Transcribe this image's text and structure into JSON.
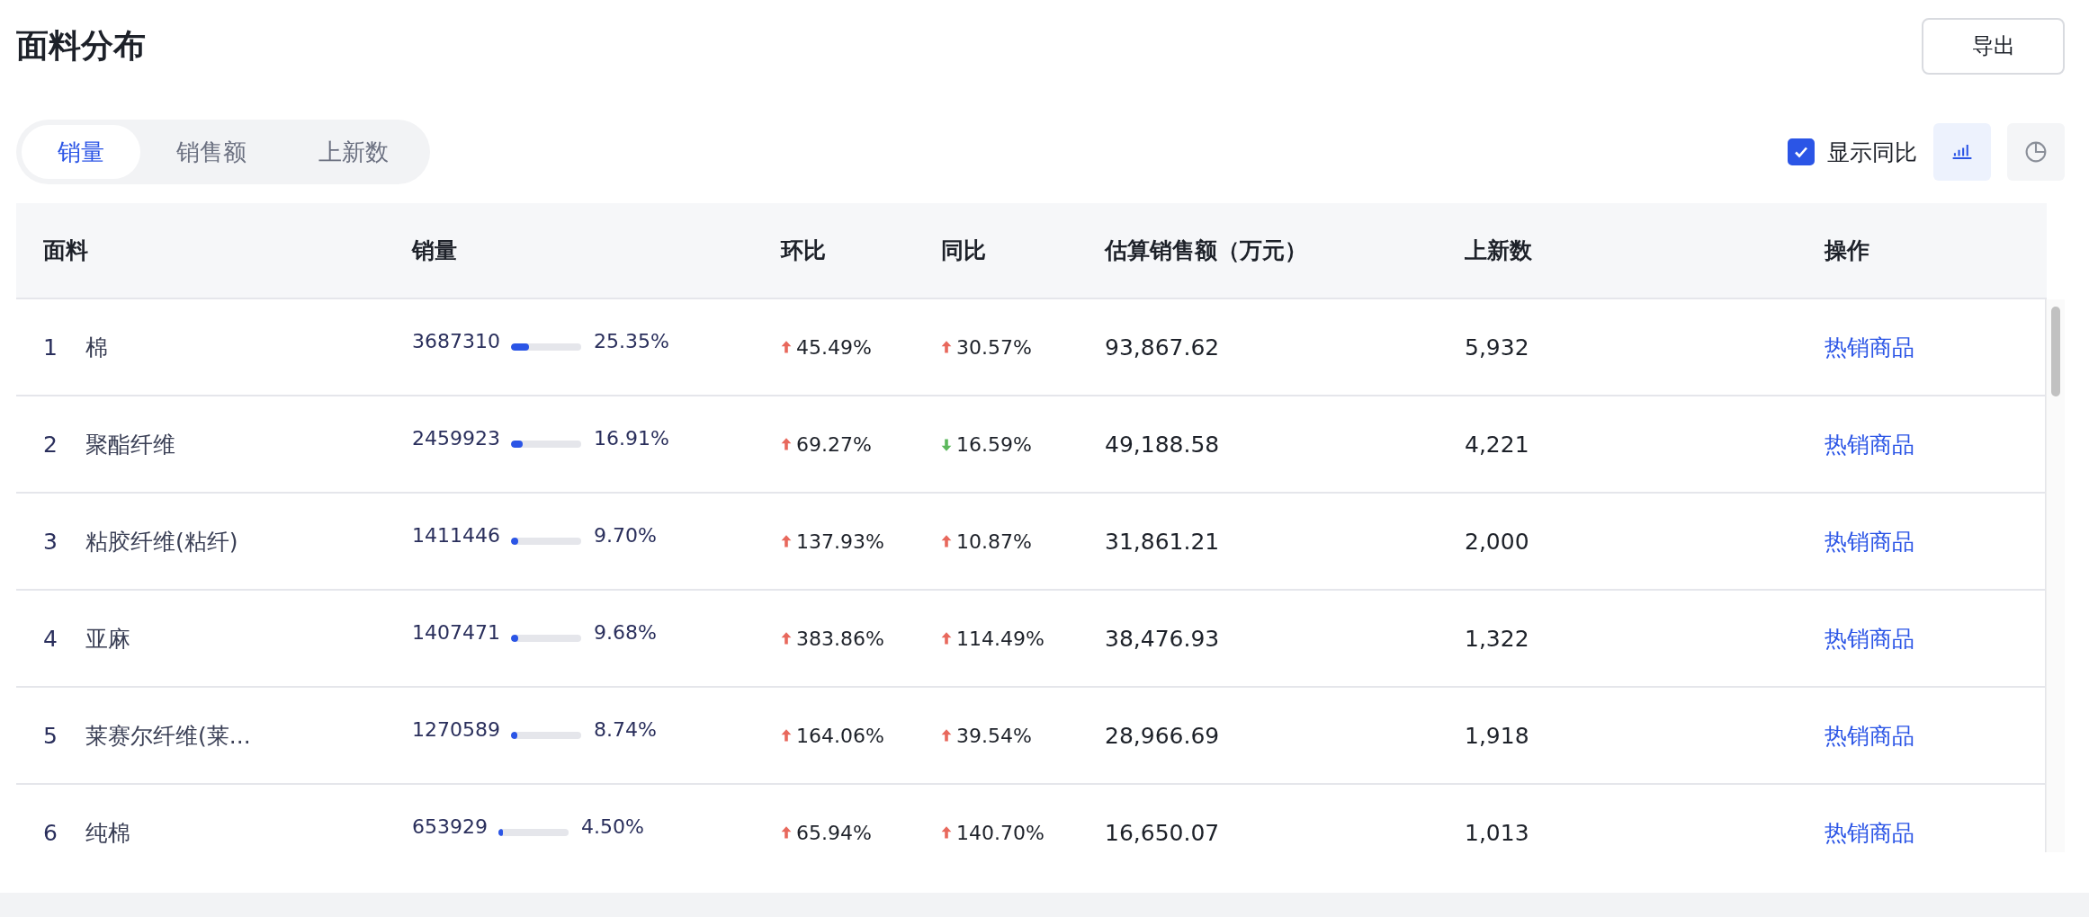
{
  "title": "面料分布",
  "export_button": "导出",
  "tabs": [
    {
      "label": "销量",
      "selected": true
    },
    {
      "label": "销售额",
      "selected": false
    },
    {
      "label": "上新数",
      "selected": false
    }
  ],
  "show_yoy": {
    "label": "显示同比",
    "checked": true
  },
  "view_toggle": [
    {
      "kind": "bar",
      "selected": true
    },
    {
      "kind": "pie",
      "selected": false
    }
  ],
  "table": {
    "columns": [
      "面料",
      "销量",
      "环比",
      "同比",
      "估算销售额（万元）",
      "上新数",
      "操作"
    ],
    "rows": [
      {
        "rank": "1",
        "name": "棉",
        "sales": "3687310",
        "level": 0.2535,
        "share": "25.35%",
        "mom": {
          "kind": "up",
          "value": "45.49%"
        },
        "yoy": {
          "kind": "up",
          "value": "30.57%"
        },
        "revenue": "93,867.62",
        "new": "5,932",
        "action": "热销商品"
      },
      {
        "rank": "2",
        "name": "聚酯纤维",
        "sales": "2459923",
        "level": 0.1691,
        "share": "16.91%",
        "mom": {
          "kind": "up",
          "value": "69.27%"
        },
        "yoy": {
          "kind": "down",
          "value": "16.59%"
        },
        "revenue": "49,188.58",
        "new": "4,221",
        "action": "热销商品"
      },
      {
        "rank": "3",
        "name": "粘胶纤维(粘纤)",
        "sales": "1411446",
        "level": 0.097,
        "share": "9.70%",
        "mom": {
          "kind": "up",
          "value": "137.93%"
        },
        "yoy": {
          "kind": "up",
          "value": "10.87%"
        },
        "revenue": "31,861.21",
        "new": "2,000",
        "action": "热销商品"
      },
      {
        "rank": "4",
        "name": "亚麻",
        "sales": "1407471",
        "level": 0.0968,
        "share": "9.68%",
        "mom": {
          "kind": "up",
          "value": "383.86%"
        },
        "yoy": {
          "kind": "up",
          "value": "114.49%"
        },
        "revenue": "38,476.93",
        "new": "1,322",
        "action": "热销商品"
      },
      {
        "rank": "5",
        "name": "莱赛尔纤维(莱...",
        "sales": "1270589",
        "level": 0.0874,
        "share": "8.74%",
        "mom": {
          "kind": "up",
          "value": "164.06%"
        },
        "yoy": {
          "kind": "up",
          "value": "39.54%"
        },
        "revenue": "28,966.69",
        "new": "1,918",
        "action": "热销商品"
      },
      {
        "rank": "6",
        "name": "纯棉",
        "sales": "653929",
        "level": 0.045,
        "share": "4.50%",
        "mom": {
          "kind": "up",
          "value": "65.94%"
        },
        "yoy": {
          "kind": "up",
          "value": "140.70%"
        },
        "revenue": "16,650.07",
        "new": "1,013",
        "action": "热销商品"
      }
    ]
  }
}
